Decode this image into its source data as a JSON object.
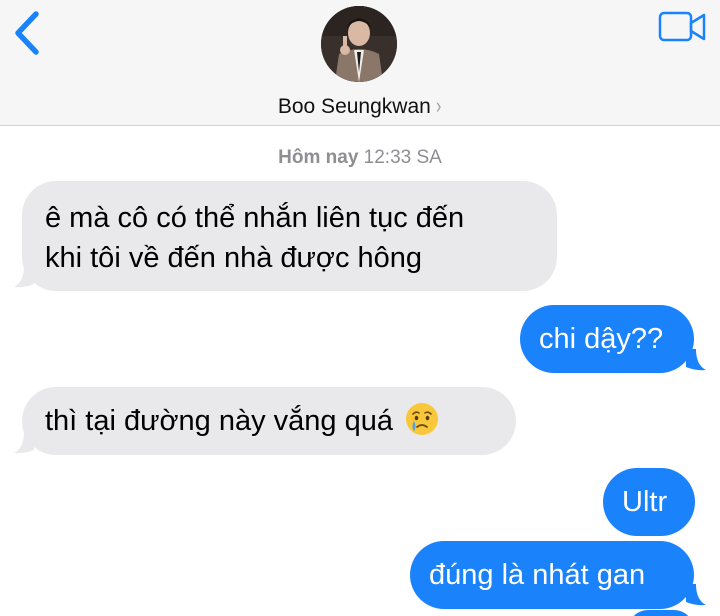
{
  "header": {
    "contact_name": "Boo Seungkwan",
    "chevron": "›",
    "back_icon": "chevron-left-icon",
    "video_icon": "video-camera-icon",
    "accent_color": "#1a82fb"
  },
  "conversation": {
    "timestamp_day": "Hôm nay",
    "timestamp_time": "12:33 SA",
    "messages": [
      {
        "direction": "incoming",
        "lines": [
          "ê mà cô có thể nhắn liên tục đến",
          "khi tôi về đến nhà được hông"
        ]
      },
      {
        "direction": "outgoing",
        "text": "chi dậy??"
      },
      {
        "direction": "incoming",
        "text": "thì tại đường này vắng quá",
        "emoji": "crying-face-emoji"
      },
      {
        "direction": "outgoing",
        "text": "Ultr"
      },
      {
        "direction": "outgoing",
        "text": "đúng là nhát gan"
      }
    ]
  },
  "colors": {
    "incoming_bubble": "#e9e9eb",
    "outgoing_bubble": "#1a82fb",
    "header_bg": "#f6f6f7"
  }
}
